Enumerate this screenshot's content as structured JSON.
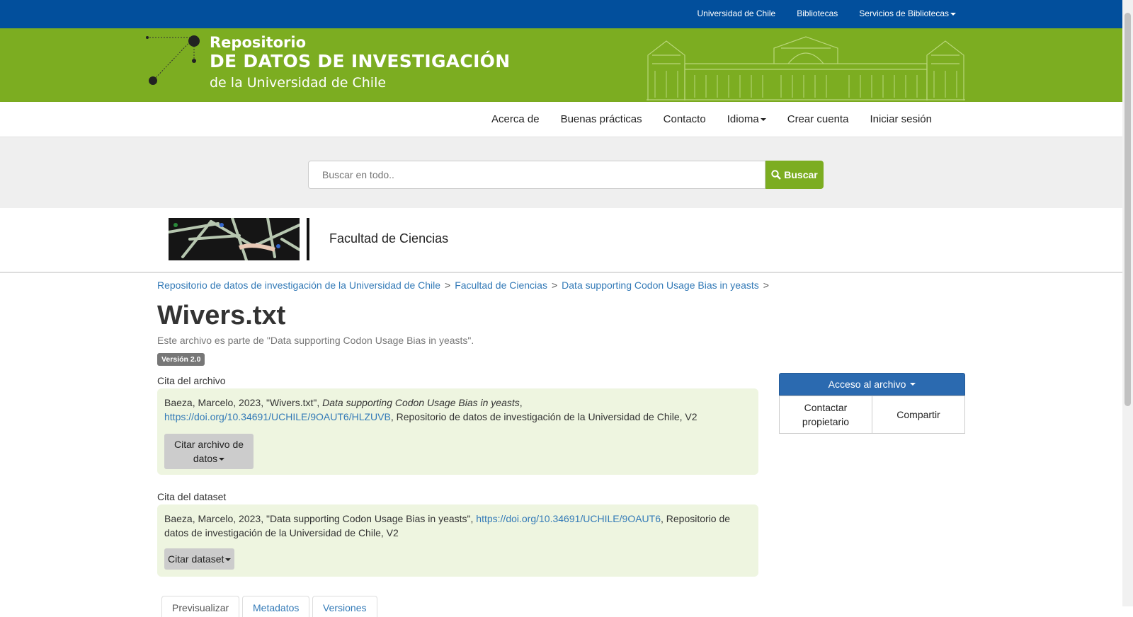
{
  "topbar": {
    "links": [
      "Universidad de Chile",
      "Bibliotecas",
      "Servicios de Bibliotecas"
    ]
  },
  "logo": {
    "line1": "Repositorio",
    "line2": "DE DATOS DE INVESTIGACIÓN",
    "line3": "de la Universidad de Chile"
  },
  "nav": {
    "items": [
      "Acerca de",
      "Buenas prácticas",
      "Contacto",
      "Idioma",
      "Crear cuenta",
      "Iniciar sesión"
    ]
  },
  "search": {
    "placeholder": "Buscar en todo..",
    "button": "Buscar"
  },
  "faculty": {
    "name": "Facultad de Ciencias"
  },
  "breadcrumb": [
    "Repositorio de datos de investigación de la Universidad de Chile",
    "Facultad de Ciencias",
    "Data supporting Codon Usage Bias in yeasts"
  ],
  "file": {
    "title": "Wivers.txt",
    "subtitle": "Este archivo es parte de \"Data supporting Codon Usage Bias in yeasts\".",
    "version": "Versión 2.0"
  },
  "file_citation": {
    "label": "Cita del archivo",
    "prefix": "Baeza, Marcelo, 2023, \"Wivers.txt\", ",
    "dataset_italic": "Data supporting Codon Usage Bias in yeasts",
    "comma": ",",
    "doi": "https://doi.org/10.34691/UCHILE/9OAUT6/HLZUVB",
    "suffix": ", Repositorio de datos de investigación de la Universidad de Chile, V2",
    "button_line1": "Citar archivo de",
    "button_line2": "datos"
  },
  "dataset_citation": {
    "label": "Cita del dataset",
    "prefix": "Baeza, Marcelo, 2023, \"Data supporting Codon Usage Bias in yeasts\", ",
    "doi": "https://doi.org/10.34691/UCHILE/9OAUT6",
    "suffix": ", Repositorio de datos de investigación de la Universidad de Chile, V2",
    "button": "Citar dataset"
  },
  "sidebar": {
    "access": "Acceso al archivo",
    "contact_line1": "Contactar",
    "contact_line2": "propietario",
    "share": "Compartir"
  },
  "tabs": [
    "Previsualizar",
    "Metadatos",
    "Versiones"
  ],
  "colors": {
    "topbar": "#024f9c",
    "brand_green": "#7cad21",
    "citation_bg": "#eef5e0",
    "access_button": "#2b6ab0",
    "link": "#337ab7"
  }
}
